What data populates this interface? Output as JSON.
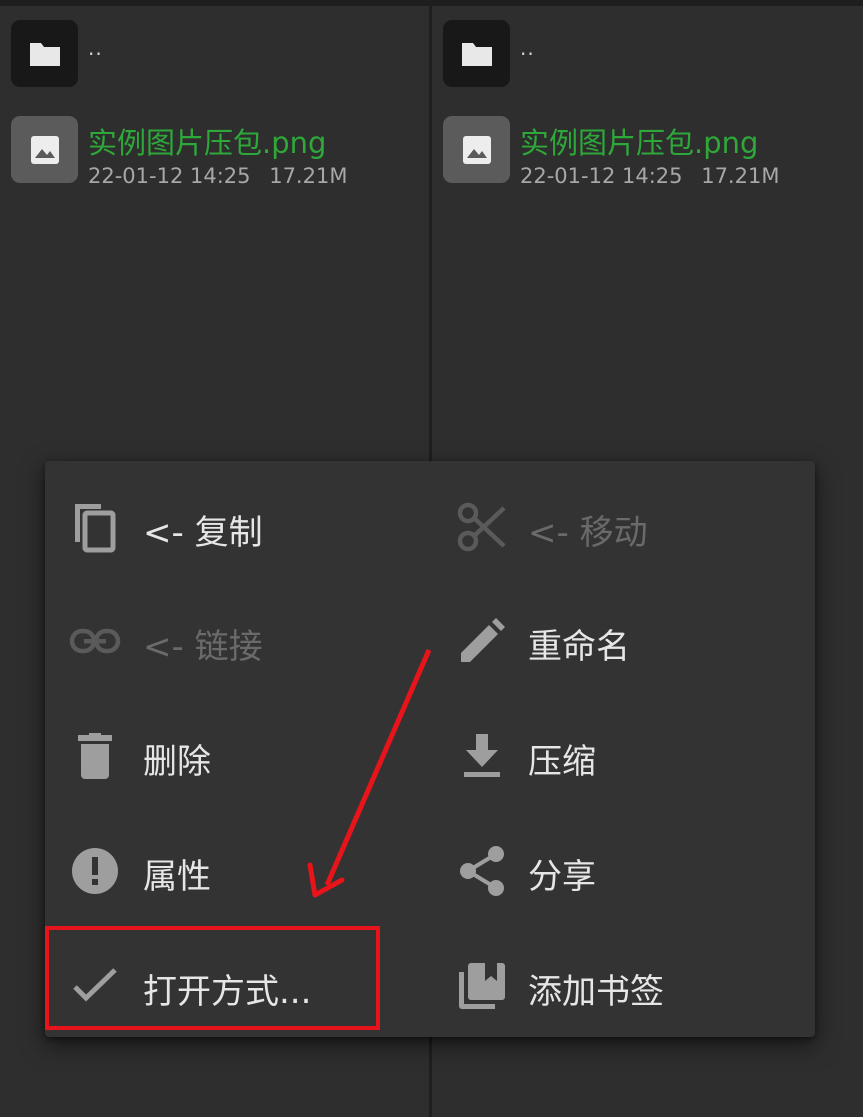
{
  "panes": [
    {
      "parent_label": "..",
      "file": {
        "name": "实例图片压包.png",
        "date": "22-01-12 14:25",
        "size": "17.21M"
      }
    },
    {
      "parent_label": "..",
      "file": {
        "name": "实例图片压包.png",
        "date": "22-01-12 14:25",
        "size": "17.21M"
      }
    }
  ],
  "menu": {
    "left": [
      {
        "label": "<- 复制",
        "icon": "copy-icon",
        "enabled": true
      },
      {
        "label": "<- 链接",
        "icon": "link-icon",
        "enabled": false
      },
      {
        "label": "删除",
        "icon": "trash-icon",
        "enabled": true
      },
      {
        "label": "属性",
        "icon": "info-icon",
        "enabled": true
      },
      {
        "label": "打开方式...",
        "icon": "check-icon",
        "enabled": true
      }
    ],
    "right": [
      {
        "label": "<- 移动",
        "icon": "scissors-icon",
        "enabled": false
      },
      {
        "label": "重命名",
        "icon": "pencil-icon",
        "enabled": true
      },
      {
        "label": "压缩",
        "icon": "download-icon",
        "enabled": true
      },
      {
        "label": "分享",
        "icon": "share-icon",
        "enabled": true
      },
      {
        "label": "添加书签",
        "icon": "bookmark-icon",
        "enabled": true
      }
    ]
  },
  "colors": {
    "file_name": "#2fa83a",
    "annotation": "#e8141b",
    "menu_bg": "#333333"
  }
}
